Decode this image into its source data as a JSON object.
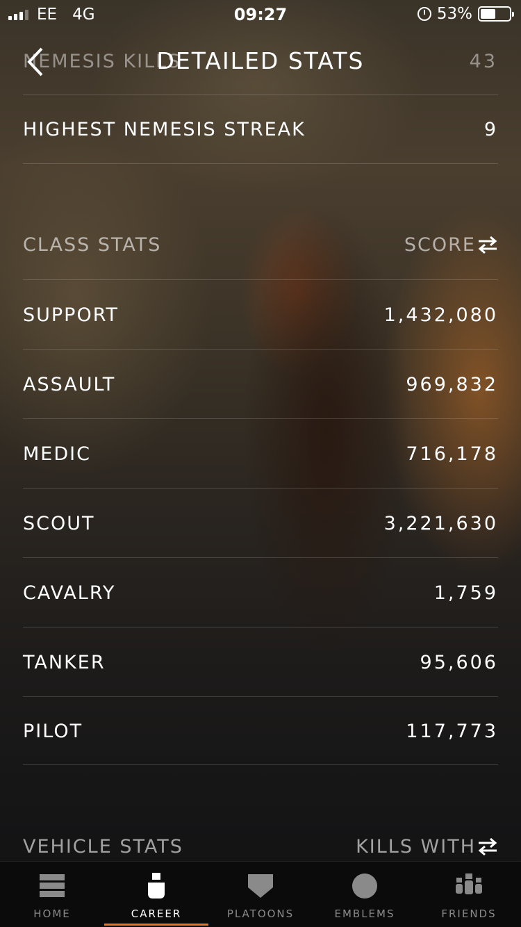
{
  "status_bar": {
    "carrier": "EE",
    "network": "4G",
    "time": "09:27",
    "battery": "53%",
    "battery_level": 0.53,
    "signal_bars": 3,
    "icons": [
      "signal-icon",
      "alarm-icon",
      "battery-icon"
    ]
  },
  "header": {
    "title": "DETAILED STATS",
    "back_icon": "chevron-left-icon",
    "peek_row": {
      "label": "NEMESIS KILLS",
      "value": "43"
    }
  },
  "top_rows": [
    {
      "label": "HIGHEST NEMESIS STREAK",
      "value": "9"
    }
  ],
  "class_stats": {
    "title": "CLASS STATS",
    "sort_label": "SCORE",
    "sort_icon": "swap-arrows-icon",
    "rows": [
      {
        "label": "SUPPORT",
        "value": "1,432,080"
      },
      {
        "label": "ASSAULT",
        "value": "969,832"
      },
      {
        "label": "MEDIC",
        "value": "716,178"
      },
      {
        "label": "SCOUT",
        "value": "3,221,630"
      },
      {
        "label": "CAVALRY",
        "value": "1,759"
      },
      {
        "label": "TANKER",
        "value": "95,606"
      },
      {
        "label": "PILOT",
        "value": "117,773"
      }
    ]
  },
  "vehicle_stats": {
    "title": "VEHICLE STATS",
    "sort_label": "KILLS WITH",
    "sort_icon": "swap-arrows-icon"
  },
  "bottom_nav": {
    "active": "CAREER",
    "accent_color": "#e87722",
    "items": [
      {
        "label": "HOME",
        "icon": "home-icon"
      },
      {
        "label": "CAREER",
        "icon": "soldier-icon"
      },
      {
        "label": "PLATOONS",
        "icon": "shield-icon"
      },
      {
        "label": "EMBLEMS",
        "icon": "circle-emblem-icon"
      },
      {
        "label": "FRIENDS",
        "icon": "friends-icon"
      }
    ]
  }
}
